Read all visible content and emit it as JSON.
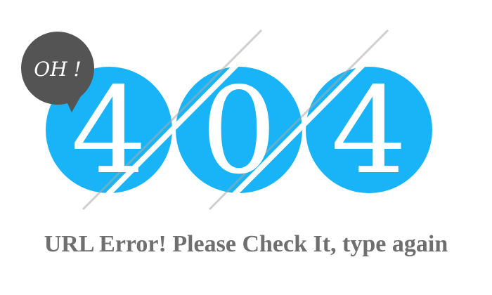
{
  "bubble": {
    "label": "OH !"
  },
  "code": {
    "digits": [
      "4",
      "0",
      "4"
    ]
  },
  "message": {
    "text": "URL Error! Please Check It, type again"
  },
  "colors": {
    "circle": "#18b4f7",
    "bubble": "#545454",
    "message": "#6f6f6f"
  },
  "icons": {
    "bubble": "speech-bubble-icon"
  }
}
